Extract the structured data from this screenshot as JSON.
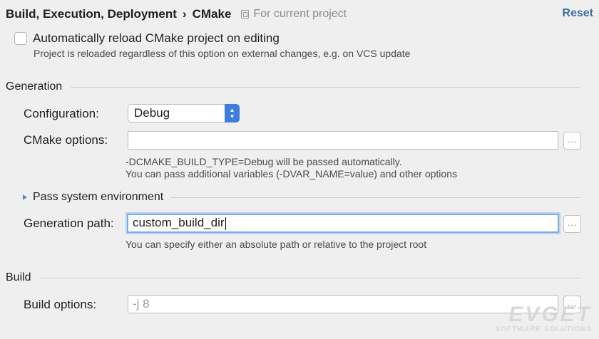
{
  "breadcrumb": {
    "parent": "Build, Execution, Deployment",
    "separator": "›",
    "current": "CMake",
    "scope": "For current project"
  },
  "reset_label": "Reset",
  "auto_reload": {
    "label": "Automatically reload CMake project on editing",
    "checked": false,
    "hint": "Project is reloaded regardless of this option on external changes, e.g. on VCS update"
  },
  "generation": {
    "title": "Generation",
    "configuration_label": "Configuration:",
    "configuration_value": "Debug",
    "cmake_options_label": "CMake options:",
    "cmake_options_value": "",
    "cmake_hint_1": "-DCMAKE_BUILD_TYPE=Debug will be passed automatically.",
    "cmake_hint_2": "You can pass additional variables (-DVAR_NAME=value) and other options",
    "pass_env_label": "Pass system environment",
    "path_label": "Generation path:",
    "path_value": "custom_build_dir",
    "path_hint": "You can specify either an absolute path or relative to the project root"
  },
  "build": {
    "title": "Build",
    "options_label": "Build options:",
    "options_placeholder": "-j 8"
  },
  "browse_label": "...",
  "watermark": {
    "brand": "EVGET",
    "tagline": "SOFTWARE SOLUTIONS"
  }
}
